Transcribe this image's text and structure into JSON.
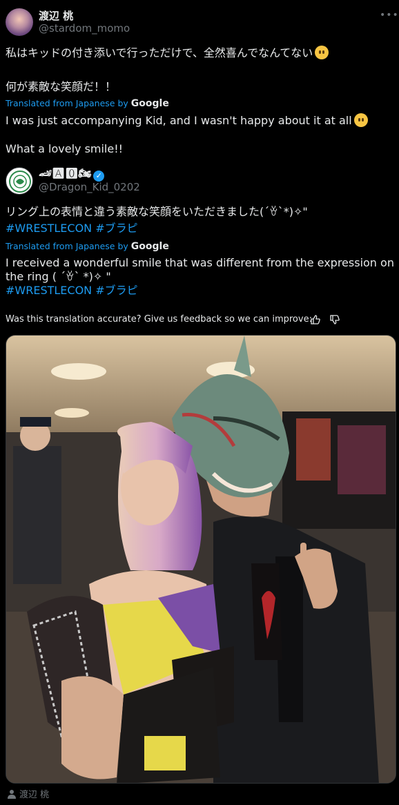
{
  "post": {
    "author_name": "渡辺 桃",
    "author_handle": "@stardom_momo",
    "text_line1": "私はキッドの付き添いで行っただけで、全然喜んでなんてない",
    "text_line2": "何が素敵な笑顔だ！！",
    "translated_from": "Translated from Japanese by",
    "google": "Google",
    "translation_line1": "I was just accompanying Kid, and I wasn't happy about it at all",
    "translation_line2": "What a lovely smile!!"
  },
  "quote": {
    "author_name": "🏎🅰🅾🏍",
    "author_handle": "@Dragon_Kid_0202",
    "text": "リング上の表情と違う素敵な笑顔をいただきました(´ꈊ`*)✧\"",
    "hashtags": "#WRESTLECON #ブラピ",
    "translated_from": "Translated from Japanese by",
    "google": "Google",
    "translation_line1": "I received a wonderful smile that was different from the expression on",
    "translation_line2": "the ring ( ´ꈊ` *)✧ \"",
    "translation_hashtags": "#WRESTLECON #ブラピ"
  },
  "feedback": {
    "text": "Was this translation accurate? Give us feedback so we can improve:"
  },
  "footer": {
    "label": "渡辺 桃"
  },
  "icons": {
    "more": "more-icon",
    "verified": "verified-badge-icon",
    "thumbs_up": "thumbs-up-icon",
    "thumbs_down": "thumbs-down-icon",
    "person": "person-icon"
  },
  "colors": {
    "background": "#000000",
    "text": "#e7e9ea",
    "muted": "#71767b",
    "accent": "#1d9bf0"
  }
}
